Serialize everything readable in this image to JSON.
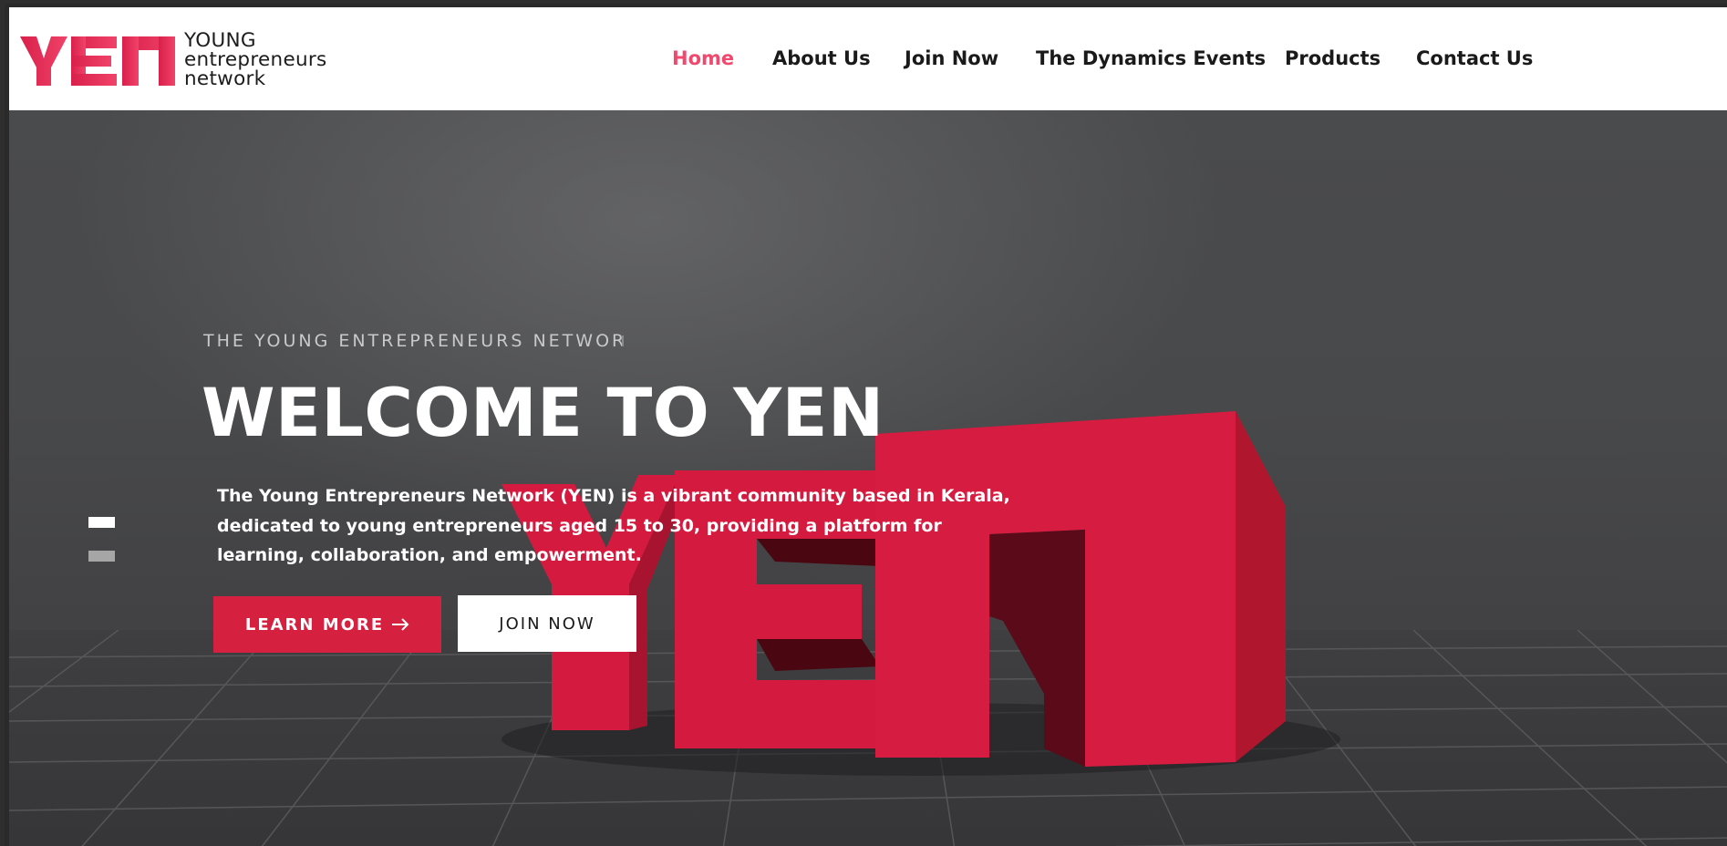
{
  "header": {
    "logo": {
      "mark": "YEN",
      "line1": "YOUNG",
      "line2": "entrepreneurs",
      "line3": "network"
    },
    "nav": [
      {
        "label": "Home",
        "active": true
      },
      {
        "label": "About Us",
        "active": false
      },
      {
        "label": "Join Now",
        "active": false
      },
      {
        "label": "The Dynamics Events",
        "active": false
      },
      {
        "label": "Products",
        "active": false
      },
      {
        "label": "Contact Us",
        "active": false
      }
    ]
  },
  "hero": {
    "eyebrow": "THE YOUNG ENTREPRENEURS NETWOR",
    "title": "WELCOME TO YEN",
    "description": "The Young Entrepreneurs Network (YEN) is a vibrant community based in Kerala, dedicated to young entrepreneurs aged 15 to 30, providing a platform for learning, collaboration, and empowerment.",
    "learn_more": "LEARN MORE",
    "join_now": "JOIN NOW",
    "slide_indicator": {
      "count": 2,
      "active_index": 0
    },
    "sculpture_text": "YEN"
  },
  "colors": {
    "brand_red": "#d6203f",
    "nav_active": "#ef4a6e",
    "header_bg": "#ffffff",
    "hero_bg": "#48494b"
  }
}
